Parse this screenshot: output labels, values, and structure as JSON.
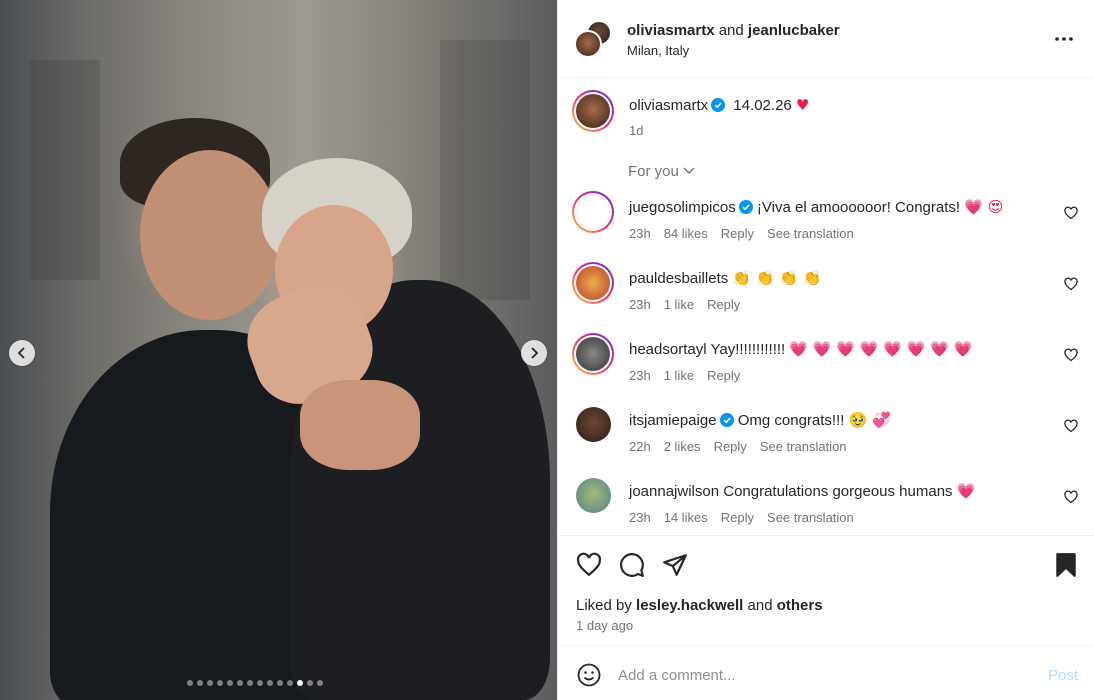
{
  "post": {
    "author_primary": "oliviasmartx",
    "and_text": "and",
    "author_secondary": "jeanlucbaker",
    "location": "Milan, Italy",
    "caption_user": "oliviasmartx",
    "caption_text": "14.02.26",
    "caption_time": "1d"
  },
  "photo": {
    "total_slides": 14,
    "active_slide": 11
  },
  "comments_filter": "For you",
  "comments": [
    {
      "user": "juegosolimpicos",
      "verified": true,
      "text": "¡Viva el amoooooor! Congrats!",
      "emoji": "💗 😍",
      "time": "23h",
      "likes": "84 likes",
      "reply": "Reply",
      "translation": "See translation"
    },
    {
      "user": "pauldesbaillets",
      "verified": false,
      "text": "",
      "emoji": "👏 👏 👏 👏",
      "time": "23h",
      "likes": "1 like",
      "reply": "Reply",
      "translation": ""
    },
    {
      "user": "headsortayl",
      "verified": false,
      "text": "Yay!!!!!!!!!!!!",
      "emoji": "💗 💗 💗 💗 💗 💗 💗 💗",
      "time": "23h",
      "likes": "1 like",
      "reply": "Reply",
      "translation": ""
    },
    {
      "user": "itsjamiepaige",
      "verified": true,
      "text": "Omg congrats!!!",
      "emoji": "🥹 💞",
      "time": "22h",
      "likes": "2 likes",
      "reply": "Reply",
      "translation": "See translation"
    },
    {
      "user": "joannajwilson",
      "verified": false,
      "text": "Congratulations gorgeous humans",
      "emoji": "💗",
      "time": "23h",
      "likes": "14 likes",
      "reply": "Reply",
      "translation": "See translation"
    }
  ],
  "likes": {
    "prefix": "Liked by",
    "user": "lesley.hackwell",
    "and": "and",
    "others": "others",
    "date": "1 day ago"
  },
  "composer": {
    "placeholder": "Add a comment...",
    "post_label": "Post"
  },
  "colors": {
    "accent_blue": "#0095f6",
    "verified_blue": "#0095f6",
    "heart_red": "#ed1d48"
  }
}
